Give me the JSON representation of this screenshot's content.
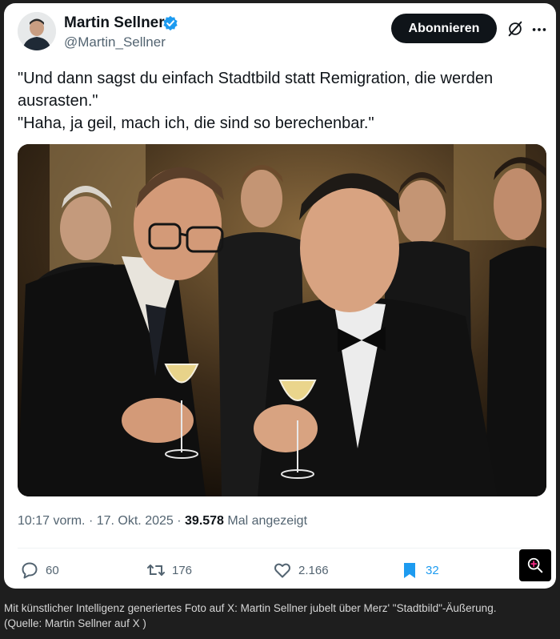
{
  "author": {
    "name": "Martin Sellner",
    "handle": "@Martin_Sellner",
    "follow_label": "Abonnieren"
  },
  "tweet": {
    "lines": [
      "\"Und dann sagst du einfach Stadtbild statt Remigration, die werden",
      "ausrasten.\"",
      "\"Haha, ja geil, mach ich, die sind so berechenbar.\""
    ]
  },
  "meta": {
    "time": "10:17 vorm.",
    "date": "17. Okt. 2025",
    "views": "39.578",
    "views_label": "Mal angezeigt"
  },
  "actions": {
    "replies": "60",
    "reposts": "176",
    "likes": "2.166",
    "bookmarks": "32"
  },
  "caption": {
    "line1": "Mit künstlicher Intelligenz generiertes Foto auf X: Martin Sellner jubelt über Merz' \"Stadtbild\"-Äußerung.",
    "line2": "(Quelle: Martin Sellner auf X )"
  },
  "colors": {
    "brand_blue": "#1d9bf0",
    "text_primary": "#0f1419",
    "text_secondary": "#536471",
    "caption_bg": "#1e1e1e"
  },
  "icons": [
    "verified-badge-icon",
    "grok-icon",
    "more-icon",
    "reply-icon",
    "repost-icon",
    "like-icon",
    "bookmark-icon",
    "zoom-icon"
  ]
}
